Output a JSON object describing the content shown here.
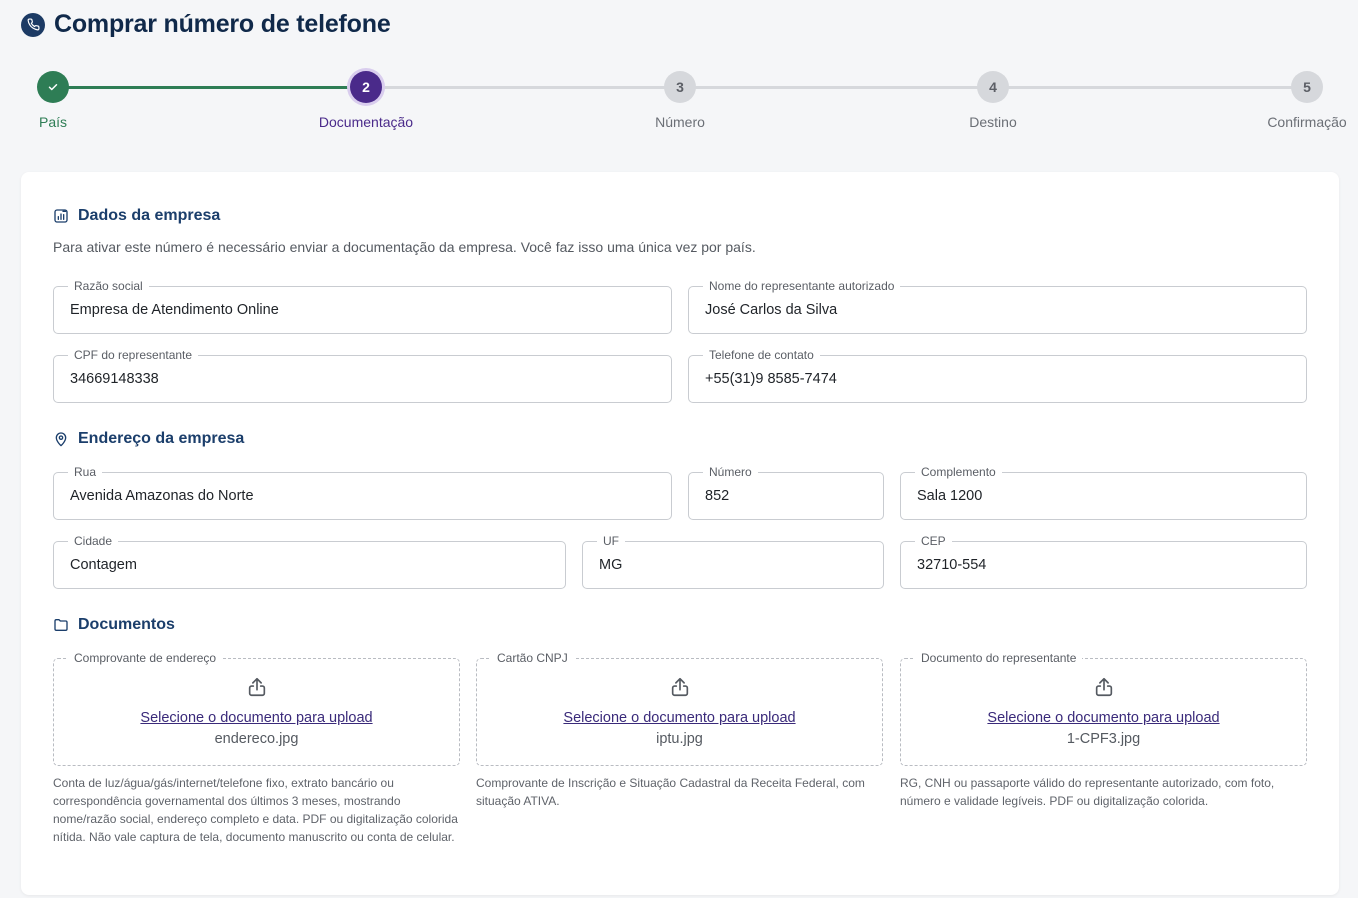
{
  "page": {
    "title": "Comprar número de telefone"
  },
  "stepper": {
    "steps": [
      {
        "number": "",
        "label": "País",
        "state": "done"
      },
      {
        "number": "2",
        "label": "Documentação",
        "state": "active"
      },
      {
        "number": "3",
        "label": "Número",
        "state": "pending"
      },
      {
        "number": "4",
        "label": "Destino",
        "state": "pending"
      },
      {
        "number": "5",
        "label": "Confirmação",
        "state": "pending"
      }
    ]
  },
  "company": {
    "title": "Dados da empresa",
    "description": "Para ativar este número é necessário enviar a documentação da empresa. Você faz isso uma única vez por país.",
    "fields": {
      "razao_social": {
        "label": "Razão social",
        "value": "Empresa de Atendimento Online"
      },
      "representante": {
        "label": "Nome do representante autorizado",
        "value": "José Carlos da Silva"
      },
      "cpf": {
        "label": "CPF do representante",
        "value": "34669148338"
      },
      "telefone": {
        "label": "Telefone de contato",
        "value": "+55(31)9 8585-7474"
      }
    }
  },
  "address": {
    "title": "Endereço da empresa",
    "fields": {
      "rua": {
        "label": "Rua",
        "value": "Avenida Amazonas do Norte"
      },
      "numero": {
        "label": "Número",
        "value": "852"
      },
      "complemento": {
        "label": "Complemento",
        "value": "Sala 1200"
      },
      "cidade": {
        "label": "Cidade",
        "value": "Contagem"
      },
      "uf": {
        "label": "UF",
        "value": "MG"
      },
      "cep": {
        "label": "CEP",
        "value": "32710-554"
      }
    }
  },
  "documents": {
    "title": "Documentos",
    "items": [
      {
        "label": "Comprovante de endereço",
        "link": "Selecione o documento para upload",
        "file": "endereco.jpg",
        "hint": "Conta de luz/água/gás/internet/telefone fixo, extrato bancário ou correspondência governamental dos últimos 3 meses, mostrando nome/razão social, endereço completo e data. PDF ou digitalização colorida nítida. Não vale captura de tela, documento manuscrito ou conta de celular."
      },
      {
        "label": "Cartão CNPJ",
        "link": "Selecione o documento para upload",
        "file": "iptu.jpg",
        "hint": "Comprovante de Inscrição e Situação Cadastral da Receita Federal, com situação ATIVA."
      },
      {
        "label": "Documento do representante",
        "link": "Selecione o documento para upload",
        "file": "1-CPF3.jpg",
        "hint": "RG, CNH ou passaporte válido do representante autorizado, com foto, número e validade legíveis. PDF ou digitalização colorida."
      }
    ]
  },
  "colors": {
    "done": "#2e7d55",
    "active": "#4a2a8a",
    "heading": "#1b3e6b",
    "link": "#3a2a7a"
  }
}
